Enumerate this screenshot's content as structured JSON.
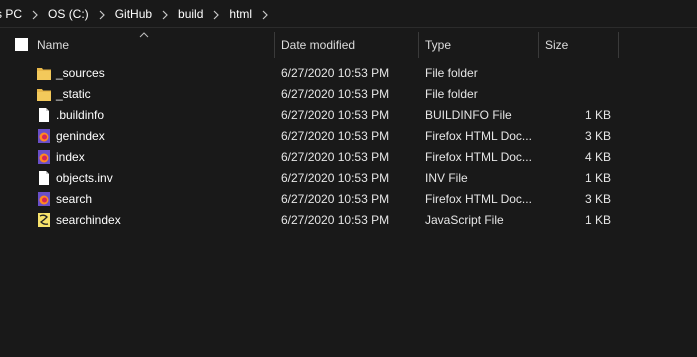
{
  "breadcrumb": {
    "items": [
      "s PC",
      "OS (C:)",
      "GitHub",
      "build",
      "html"
    ]
  },
  "header": {
    "name": "Name",
    "date_modified": "Date modified",
    "type": "Type",
    "size": "Size"
  },
  "files": [
    {
      "icon": "folder-icon",
      "name": "_sources",
      "date": "6/27/2020 10:53 PM",
      "type": "File folder",
      "size": ""
    },
    {
      "icon": "folder-icon",
      "name": "_static",
      "date": "6/27/2020 10:53 PM",
      "type": "File folder",
      "size": ""
    },
    {
      "icon": "file-icon",
      "name": ".buildinfo",
      "date": "6/27/2020 10:53 PM",
      "type": "BUILDINFO File",
      "size": "1 KB"
    },
    {
      "icon": "firefox-icon",
      "name": "genindex",
      "date": "6/27/2020 10:53 PM",
      "type": "Firefox HTML Doc...",
      "size": "3 KB"
    },
    {
      "icon": "firefox-icon",
      "name": "index",
      "date": "6/27/2020 10:53 PM",
      "type": "Firefox HTML Doc...",
      "size": "4 KB"
    },
    {
      "icon": "file-icon",
      "name": "objects.inv",
      "date": "6/27/2020 10:53 PM",
      "type": "INV File",
      "size": "1 KB"
    },
    {
      "icon": "firefox-icon",
      "name": "search",
      "date": "6/27/2020 10:53 PM",
      "type": "Firefox HTML Doc...",
      "size": "3 KB"
    },
    {
      "icon": "javascript-icon",
      "name": "searchindex",
      "date": "6/27/2020 10:53 PM",
      "type": "JavaScript File",
      "size": "1 KB"
    }
  ],
  "colors": {
    "background": "#191919",
    "folder": "#e8b84a",
    "text": "#ffffff"
  }
}
